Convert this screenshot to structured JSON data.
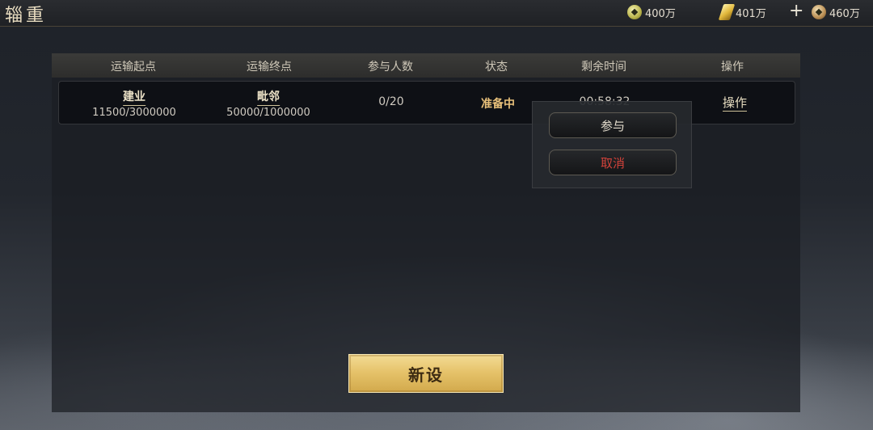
{
  "page": {
    "title": "辎重"
  },
  "currencies": {
    "jade": {
      "value": "400万",
      "icon": "jade-coin-icon"
    },
    "gold": {
      "value": "401万",
      "icon": "gold-ingot-icon"
    },
    "add_icon": "plus-icon",
    "copper": {
      "value": "460万",
      "icon": "copper-coin-icon"
    }
  },
  "table": {
    "headers": [
      "运输起点",
      "运输终点",
      "参与人数",
      "状态",
      "剩余时间",
      "操作"
    ],
    "rows": [
      {
        "origin_name": "建业",
        "origin_amount": "11500/3000000",
        "dest_name": "毗邻",
        "dest_amount": "50000/1000000",
        "participants": "0/20",
        "status": "准备中",
        "time_left": "00:58:32",
        "action": "操作"
      }
    ]
  },
  "popup": {
    "join_label": "参与",
    "cancel_label": "取消"
  },
  "footer": {
    "new_label": "新设"
  },
  "colors": {
    "status_text": "#e8c07a",
    "cancel_text": "#d2423a",
    "gold_button": "#e6c36b"
  }
}
